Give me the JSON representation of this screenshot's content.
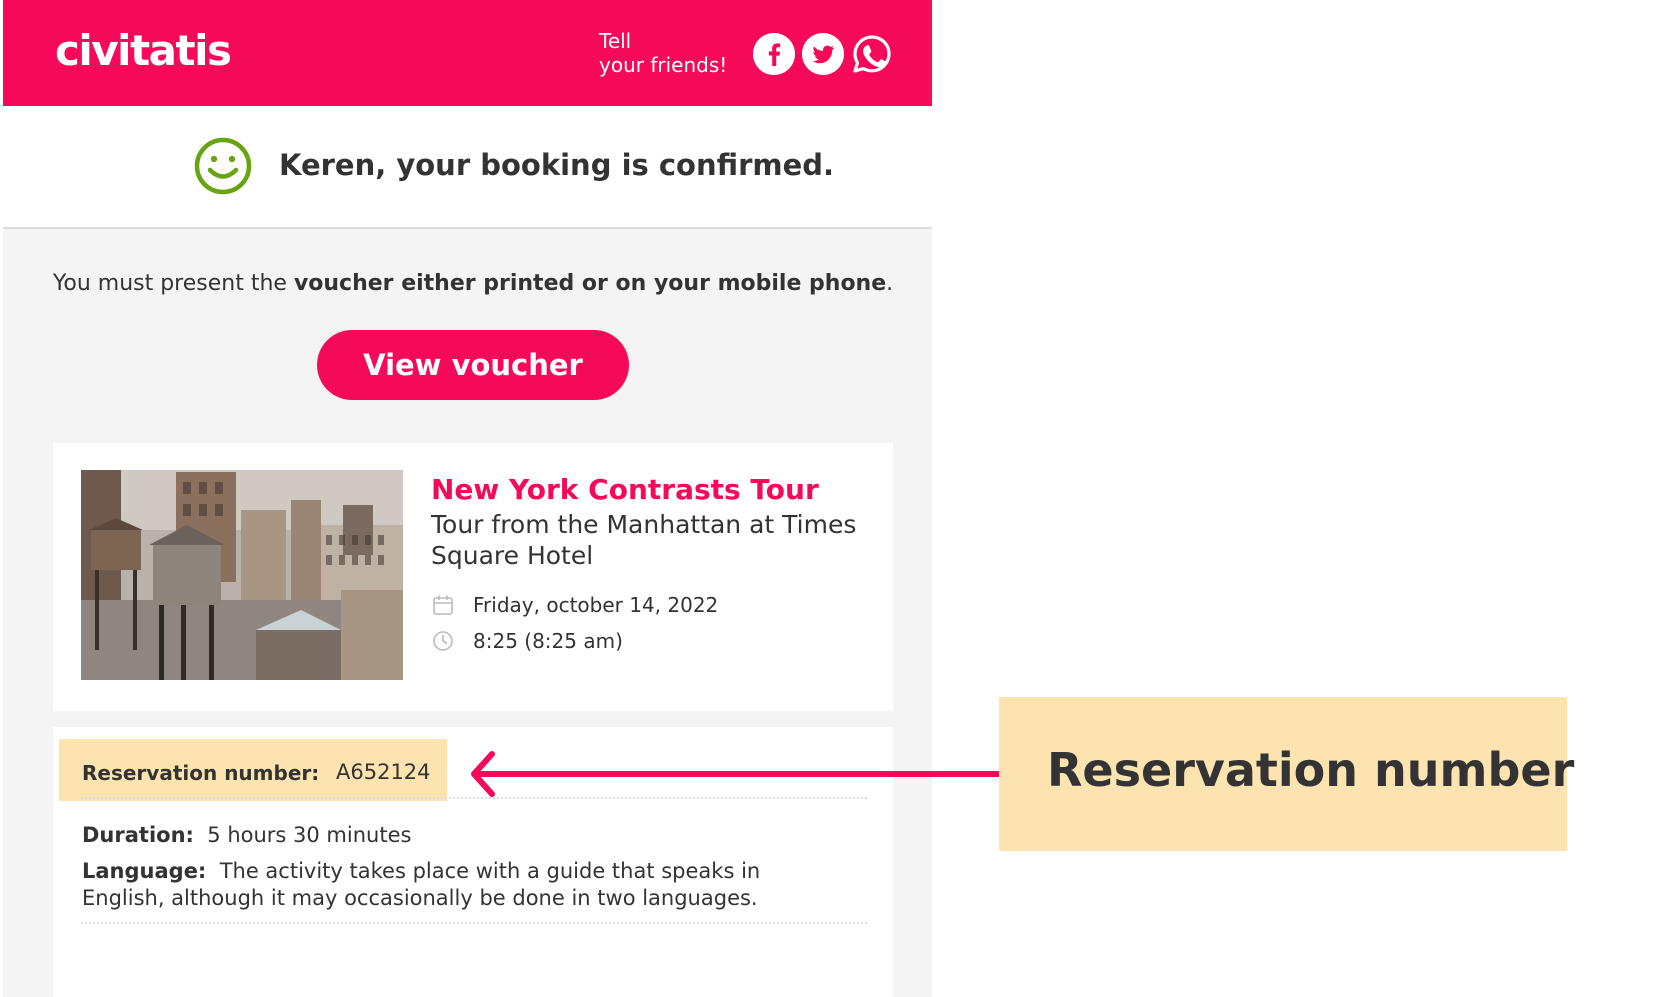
{
  "header": {
    "logo": "civitatis",
    "tell_line1": "Tell",
    "tell_line2": "your friends!",
    "social": [
      "facebook-icon",
      "twitter-icon",
      "whatsapp-icon"
    ],
    "brand_color": "#f50a5a"
  },
  "confirmation": {
    "message": "Keren, your booking is confirmed.",
    "icon": "smiley-icon",
    "icon_color": "#66a410"
  },
  "instruction": {
    "prefix": "You must present the ",
    "bold": "voucher either printed or on your mobile phone",
    "suffix": "."
  },
  "voucher_button": "View voucher",
  "tour": {
    "title": "New York Contrasts Tour",
    "subtitle": "Tour from the Manhattan at Times Square Hotel",
    "date": "Friday, october 14, 2022",
    "time": "8:25 (8:25 am)",
    "image": "new-york-rooftops-water-towers-photo"
  },
  "details": {
    "reservation_label": "Reservation number:",
    "reservation_value": "A652124",
    "duration_label": "Duration:",
    "duration_value": "5 hours 30 minutes",
    "language_label": "Language:",
    "language_value": "The activity takes place with a guide that speaks in English, although it may occasionally be done in two languages."
  },
  "annotation": {
    "callout": "Reservation number",
    "highlight_color": "#fce3b0",
    "arrow_color": "#f50a5a"
  }
}
